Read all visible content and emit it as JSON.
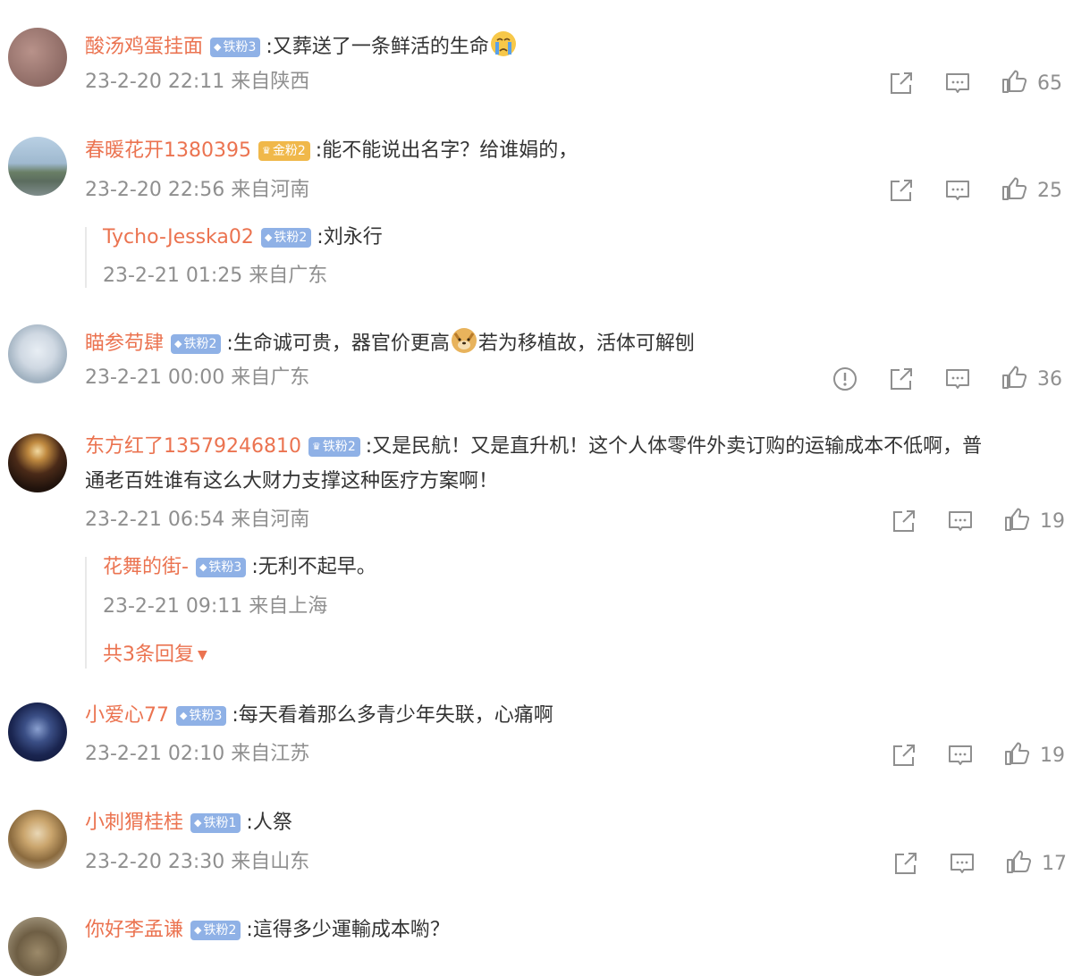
{
  "comments": [
    {
      "user": "酸汤鸡蛋挂面",
      "badge": "铁粉3",
      "badge_type": "iron",
      "text_before": ":又葬送了一条鲜活的生命",
      "emoji": "crying-face",
      "text_after": "",
      "meta": "23-2-20 22:11 来自陕西",
      "likes": "65"
    },
    {
      "user": "春暖花开1380395",
      "badge": "金粉2",
      "badge_type": "gold",
      "text_before": ":能不能说出名字？给谁娟的，",
      "emoji": "",
      "text_after": "",
      "meta": "23-2-20 22:56 来自河南",
      "likes": "25",
      "reply": {
        "user": "Tycho-Jesska02",
        "badge": "铁粉2",
        "text": ":刘永行",
        "meta": "23-2-21 01:25 来自广东"
      }
    },
    {
      "user": "瞄参苟肆",
      "badge": "铁粉2",
      "badge_type": "iron",
      "text_before": ":生命诚可贵，器官价更高",
      "emoji": "doge-face",
      "text_after": "若为移植故，活体可解刨",
      "meta": "23-2-21 00:00 来自广东",
      "likes": "36"
    },
    {
      "user": "东方红了13579246810",
      "badge": "铁粉2",
      "badge_type": "iron",
      "text_line1": ":又是民航！又是直升机！这个人体零件外卖订购的运输成本不低啊，普",
      "text_line2": "通老百姓谁有这么大财力支撑这种医疗方案啊！",
      "meta": "23-2-21 06:54 来自河南",
      "likes": "19",
      "reply": {
        "user": "花舞的街-",
        "badge": "铁粉3",
        "text": ":无利不起早。",
        "meta": "23-2-21 09:11 来自上海"
      },
      "more_replies": "共3条回复"
    },
    {
      "user": "小爱心77",
      "badge": "铁粉3",
      "badge_type": "iron",
      "text_before": ":每天看着那么多青少年失联，心痛啊",
      "emoji": "",
      "text_after": "",
      "meta": "23-2-21 02:10 来自江苏",
      "likes": "19"
    },
    {
      "user": "小刺猬桂桂",
      "badge": "铁粉1",
      "badge_type": "iron",
      "text_before": ":人祭",
      "emoji": "",
      "text_after": "",
      "meta": "23-2-20 23:30 来自山东",
      "likes": "17"
    },
    {
      "user": "你好李孟谦",
      "badge": "铁粉2",
      "badge_type": "iron",
      "text_before": ":這得多少運輸成本喲？",
      "emoji": "",
      "text_after": ""
    }
  ],
  "icons": {
    "share": "share-icon",
    "comment": "comment-icon",
    "like": "thumbs-up-icon",
    "report": "report-icon",
    "expand": "caret-down-icon"
  },
  "colors": {
    "username": "#eb7350",
    "meta": "#8f8f8f",
    "iron_badge": "#8fb1e6",
    "gold_badge": "#f0b84a"
  }
}
